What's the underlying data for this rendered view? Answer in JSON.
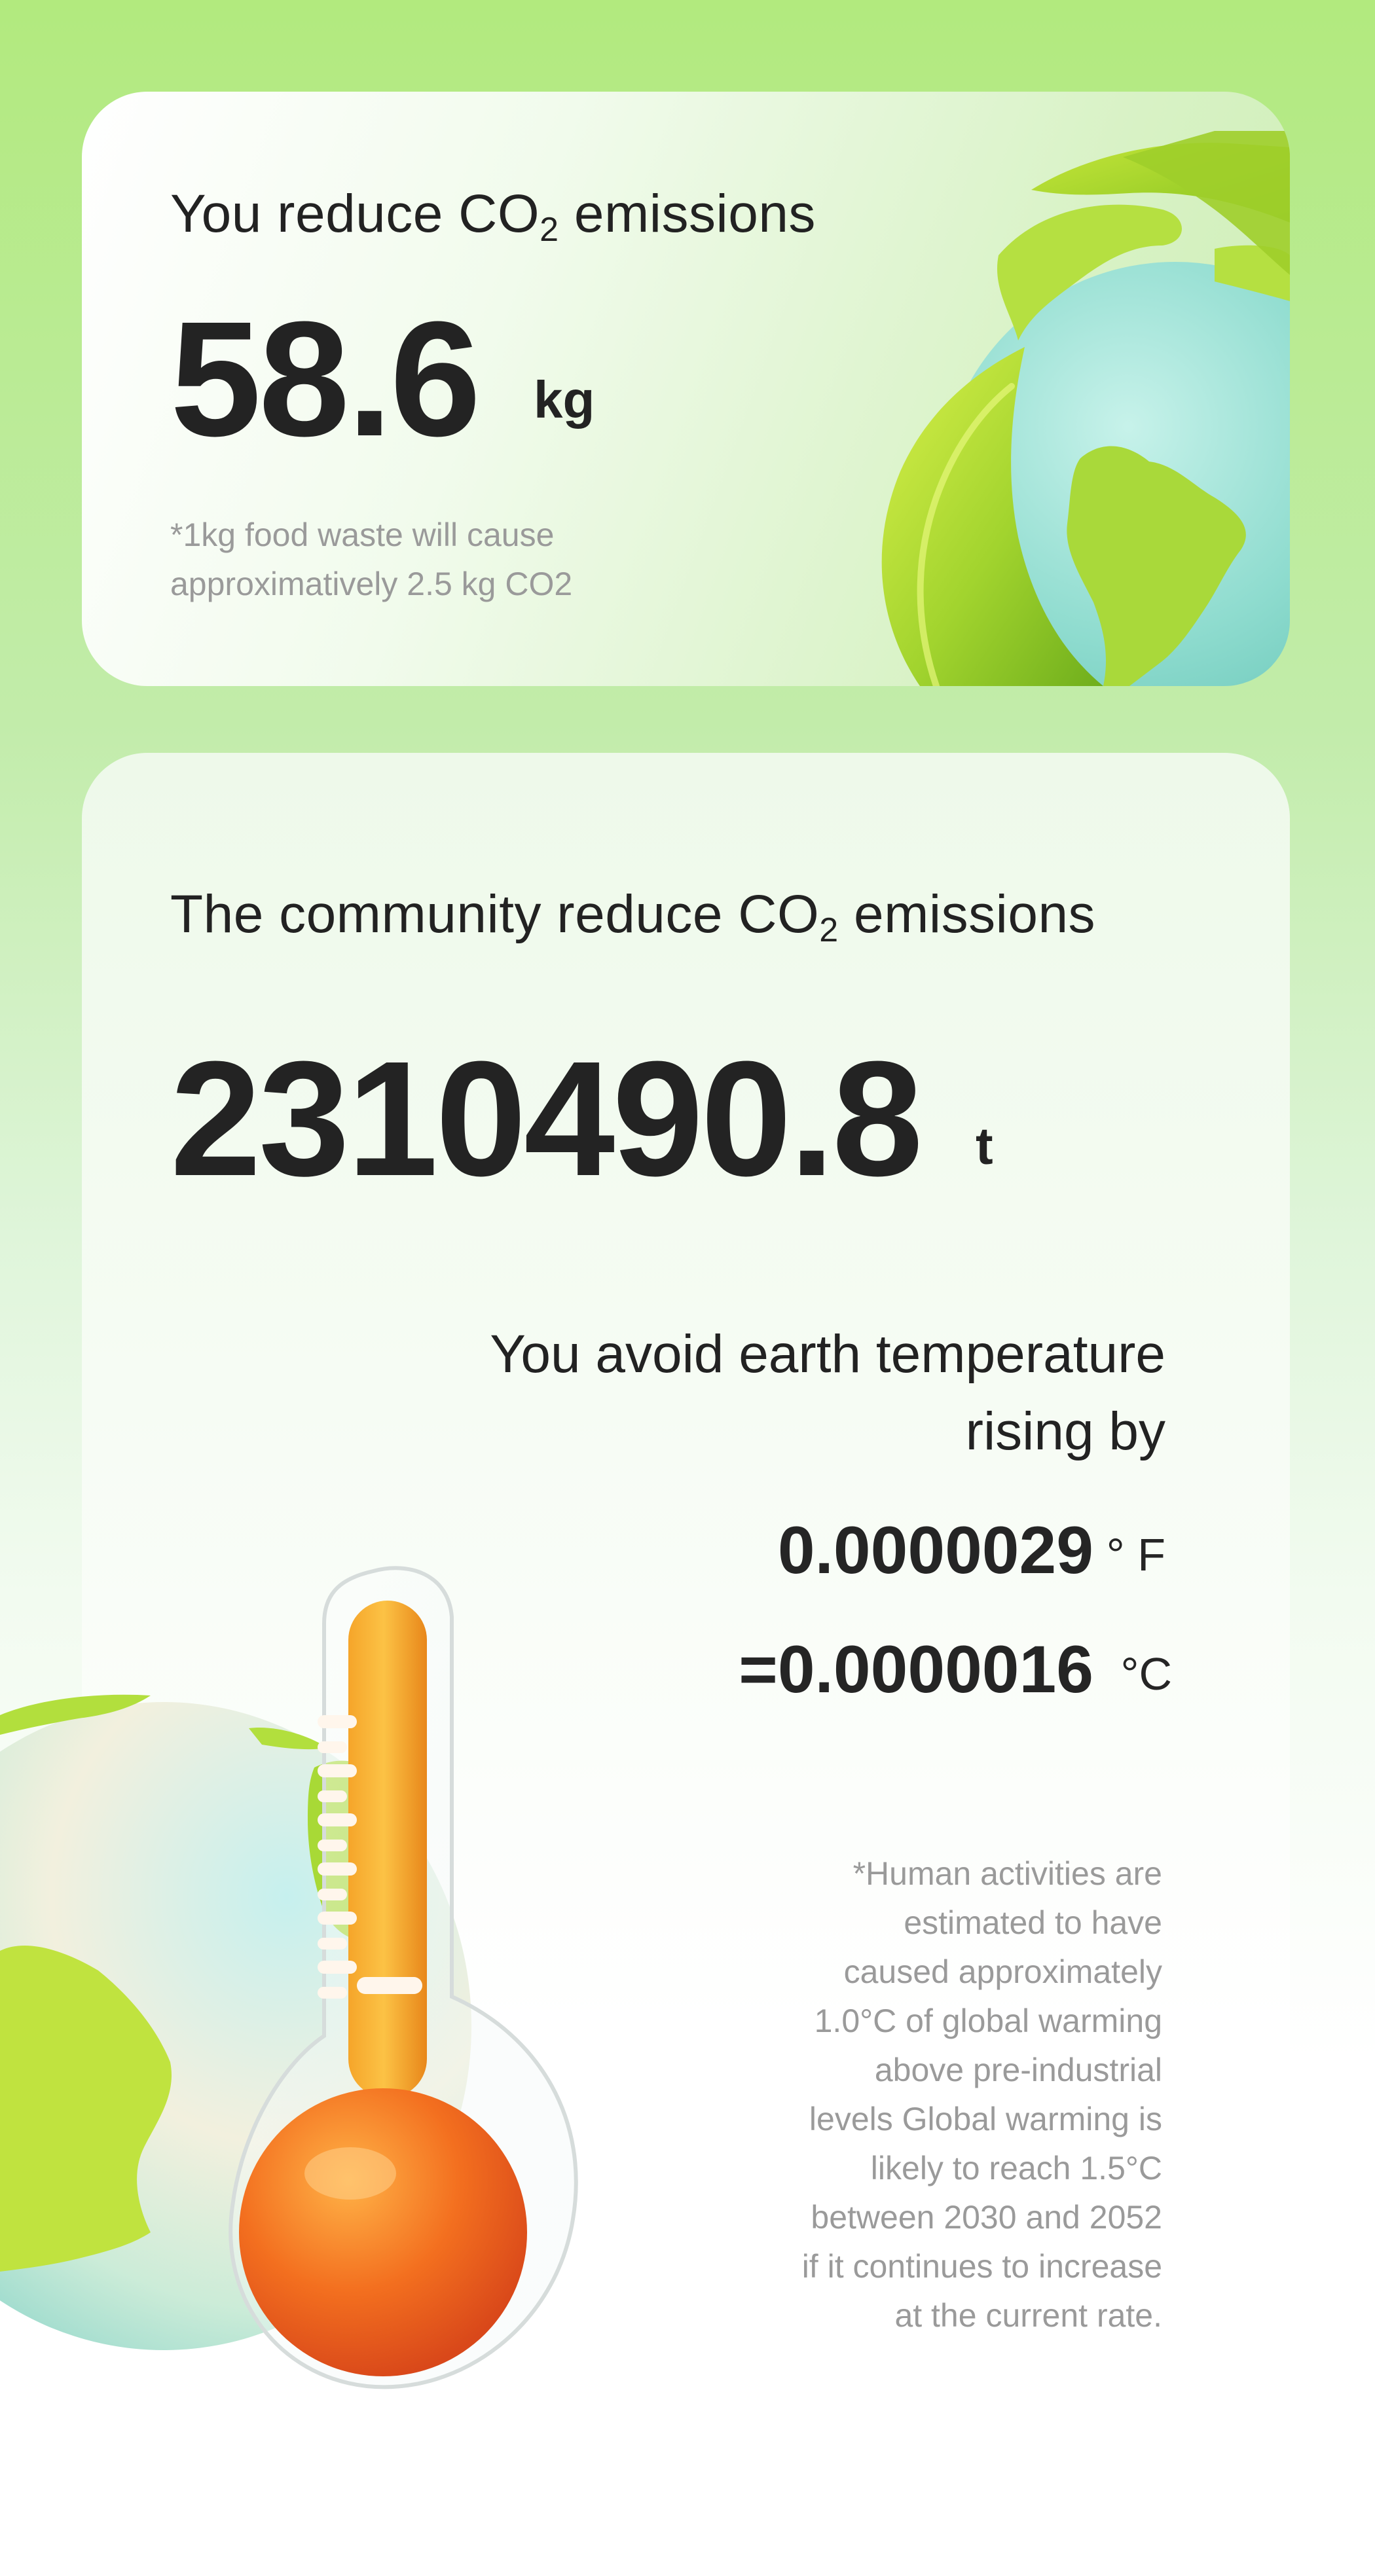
{
  "personal": {
    "heading_pre": "You reduce CO",
    "heading_sub": "2",
    "heading_post": " emissions",
    "value": "58.6",
    "unit": "kg",
    "note_line1": "*1kg food waste will cause",
    "note_line2": "approximatively 2.5 kg CO2"
  },
  "community": {
    "heading_pre": "The community reduce CO",
    "heading_sub": "2",
    "heading_post": " emissions",
    "value": "2310490.8",
    "unit": "t"
  },
  "temperature": {
    "line1": "You avoid earth temperature",
    "line2": "rising by",
    "fahrenheit_value": "0.0000029",
    "fahrenheit_unit": "° F",
    "celsius_value": "=0.0000016",
    "celsius_unit": "°C"
  },
  "disclaimer": {
    "lines": [
      "*Human activities are",
      "estimated to have",
      "caused approximately",
      "1.0°C of global warming",
      "above pre-industrial",
      "levels Global warming is",
      "likely to reach 1.5°C",
      "between 2030 and 2052",
      "if it continues to increase",
      "at the current rate."
    ]
  },
  "icons": {
    "earth_with_leaves": "earth-leaves-icon",
    "earth": "earth-icon",
    "thermometer": "thermometer-icon"
  },
  "colors": {
    "background_top": "#b2ea7e",
    "text_dark": "#222222",
    "text_muted": "#9a9a9a",
    "earth_ocean": "#8fdcd0",
    "land_green": "#a6d93a",
    "thermometer_orange": "#f08a1c"
  }
}
